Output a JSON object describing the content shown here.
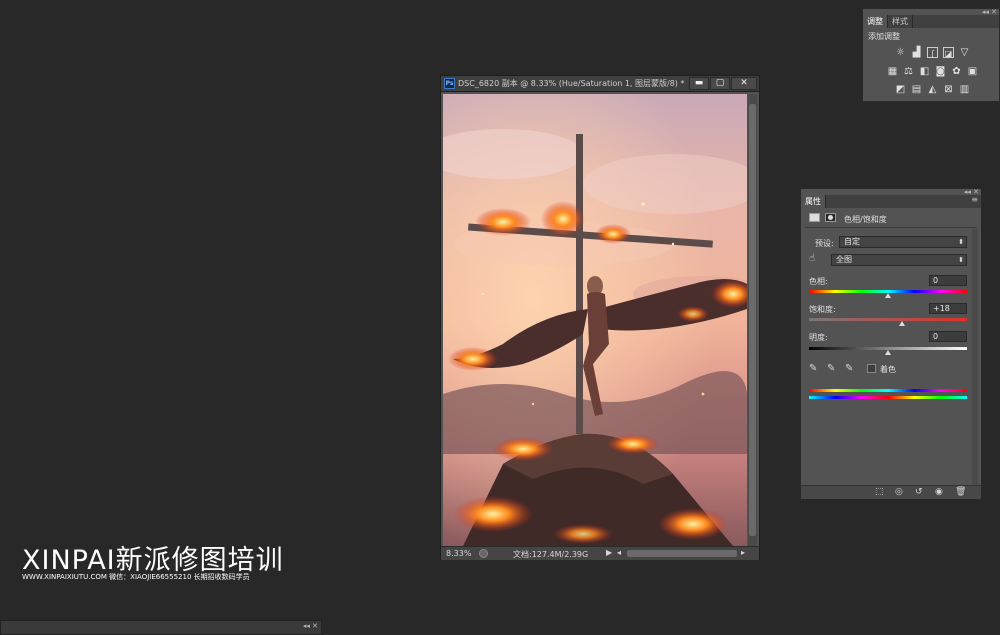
{
  "document": {
    "title": "DSC_6820 副本 @ 8.33% (Hue/Saturation 1, 图层蒙版/8) *",
    "ps_badge": "Ps",
    "status_zoom": "8.33%",
    "status_doc": "文档:127.4M/2.39G",
    "win_minimize": "▬",
    "win_maximize": "▢",
    "win_close": "✕"
  },
  "adjustments_panel": {
    "tabs": [
      "调整",
      "样式"
    ],
    "title": "添加调整",
    "icons_row1": [
      "brightness-icon",
      "levels-icon",
      "curves-icon",
      "exposure-icon",
      "vibrance-icon"
    ],
    "icons_row2": [
      "hue-saturation-icon",
      "color-balance-icon",
      "black-white-icon",
      "photo-filter-icon",
      "channel-mixer-icon",
      "color-lookup-icon"
    ],
    "icons_row3": [
      "invert-icon",
      "posterize-icon",
      "threshold-icon",
      "selective-color-icon",
      "gradient-map-icon"
    ]
  },
  "properties_panel": {
    "tab": "属性",
    "title": "色相/饱和度",
    "preset_label": "预设:",
    "preset_value": "自定",
    "channel_value": "全图",
    "hue_label": "色相:",
    "hue_value": "0",
    "hue_position": 0.5,
    "saturation_label": "饱和度:",
    "saturation_value": "+18",
    "saturation_position": 0.59,
    "lightness_label": "明度:",
    "lightness_value": "0",
    "lightness_position": 0.5,
    "colorize_label": "着色",
    "colorize_checked": false
  },
  "watermark": {
    "brand": "XINPAI新派修图培训",
    "line": "WWW.XINPAIXIUTU.COM  微信：XIAOJIE66555210 长期招收数码学员"
  },
  "colors": {
    "app_bg": "#282828",
    "panel_bg": "#535353",
    "accent_fire": "#ff5a1a"
  }
}
